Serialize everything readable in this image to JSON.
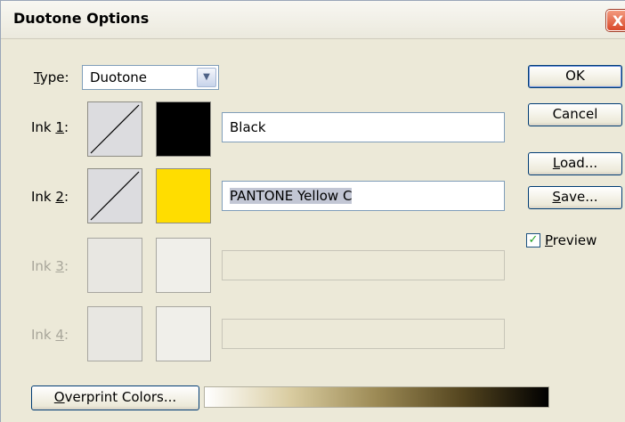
{
  "window": {
    "title": "Duotone Options",
    "close_glyph": "X"
  },
  "type": {
    "label_prefix": "T",
    "label_rest": "ype:",
    "selected": "Duotone"
  },
  "inks": [
    {
      "label_pre": "Ink ",
      "label_key": "1",
      "label_post": ":",
      "name": "Black",
      "color": "#000000",
      "enabled": true
    },
    {
      "label_pre": "Ink ",
      "label_key": "2",
      "label_post": ":",
      "name": "PANTONE Yellow C",
      "color": "#ffdd00",
      "enabled": true
    },
    {
      "label_pre": "Ink ",
      "label_key": "3",
      "label_post": ":",
      "name": "",
      "enabled": false
    },
    {
      "label_pre": "Ink ",
      "label_key": "4",
      "label_post": ":",
      "name": "",
      "enabled": false
    }
  ],
  "buttons": {
    "ok": "OK",
    "cancel": "Cancel",
    "load_key": "L",
    "load_rest": "oad...",
    "save_key": "S",
    "save_rest": "ave..."
  },
  "preview": {
    "key": "P",
    "rest": "review",
    "checked": true,
    "check_glyph": "✓"
  },
  "overprint": {
    "key": "O",
    "rest": "verprint Colors..."
  },
  "icons": {
    "close": "close-icon",
    "dropdown": "chevron-down-icon",
    "curve": "curve-icon",
    "check": "check-icon"
  }
}
